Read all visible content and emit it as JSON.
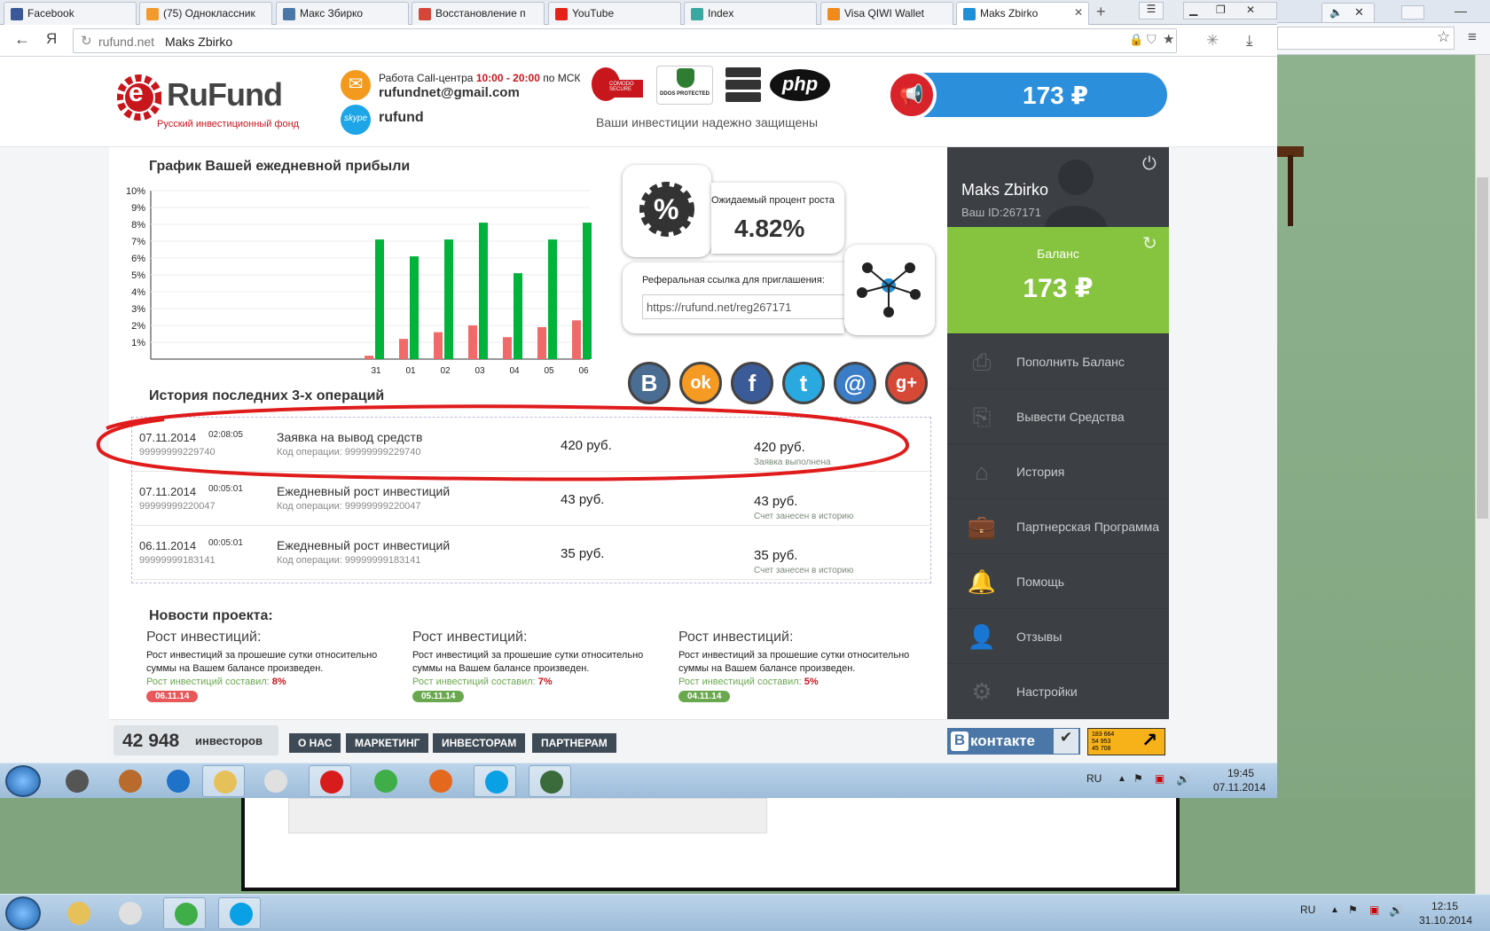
{
  "browser": {
    "tabs": [
      {
        "label": "Facebook",
        "color": "#3b5998"
      },
      {
        "label": "(75) Одноклассник",
        "color": "#f29a2e"
      },
      {
        "label": "Макс Збирко",
        "color": "#4a76a8"
      },
      {
        "label": "Восстановление п",
        "color": "#d44638"
      },
      {
        "label": "YouTube",
        "color": "#e62117"
      },
      {
        "label": "Index",
        "color": "#3aa7a0"
      },
      {
        "label": "Visa QIWI Wallet",
        "color": "#f08a1c"
      },
      {
        "label": "Maks Zbirko",
        "color": "#1e8fd6"
      }
    ],
    "back_icon": "back-arrow-icon",
    "yandex_logo": "Я",
    "url_domain": "rufund.net",
    "url_title": "Maks Zbirko"
  },
  "header": {
    "logo_text": "RuFund",
    "logo_letter": "e",
    "logo_sub": "Русский инвестиционный фонд",
    "callcenter_prefix": "Работа Call-центра ",
    "callcenter_hours": "10:00 - 20:00",
    "callcenter_suffix": " по МСК",
    "email": "rufundnet@gmail.com",
    "skype_icon_text": "skype",
    "skype": "rufund",
    "comodo_label": "COMODO SECURE",
    "ddos_label": "DDOS PROTECTED",
    "php_label": "php",
    "security_text": "Ваши инвестиции надежно защищены",
    "balance_display": "173 ₽"
  },
  "chart_data": {
    "type": "bar",
    "title": "График Вашей ежедневной прибыли",
    "categories": [
      "31",
      "01",
      "02",
      "03",
      "04",
      "05",
      "06"
    ],
    "yticks": [
      "10%",
      "9%",
      "8%",
      "7%",
      "6%",
      "5%",
      "4%",
      "3%",
      "2%",
      "1%"
    ],
    "ylim": [
      0,
      10
    ],
    "series": [
      {
        "name": "",
        "color": "#f06a6a",
        "values": [
          0.2,
          1.2,
          1.6,
          2.0,
          1.3,
          1.9,
          2.3
        ]
      },
      {
        "name": "",
        "color": "#00b33a",
        "values": [
          7.1,
          6.1,
          7.1,
          8.1,
          5.1,
          7.1,
          8.1
        ]
      }
    ]
  },
  "growth": {
    "label": "Ожидаемый процент роста",
    "value": "4.82%",
    "icon": "%"
  },
  "referral": {
    "label": "Реферальная ссылка для приглашения:",
    "url": "https://rufund.net/reg267171"
  },
  "social": [
    {
      "name": "vk",
      "glyph": "В",
      "color": "#4a6d93"
    },
    {
      "name": "odnoklassniki",
      "glyph": "ok",
      "color": "#f59a23"
    },
    {
      "name": "facebook",
      "glyph": "f",
      "color": "#3b5b98"
    },
    {
      "name": "twitter",
      "glyph": "t",
      "color": "#2aa8e0"
    },
    {
      "name": "email",
      "glyph": "@",
      "color": "#3a7cc6"
    },
    {
      "name": "google-plus",
      "glyph": "g+",
      "color": "#d64937"
    }
  ],
  "history": {
    "title": "История последних 3-х операций",
    "code_prefix": "Код операции: ",
    "rows": [
      {
        "date": "07.11.2014",
        "time": "02:08:05",
        "id": "99999999229740",
        "desc": "Заявка на вывод средств",
        "code": "99999999229740",
        "amount": "420 руб.",
        "amount2": "420 руб.",
        "status": "Заявка выполнена"
      },
      {
        "date": "07.11.2014",
        "time": "00:05:01",
        "id": "99999999220047",
        "desc": "Ежедневный рост инвестиций",
        "code": "99999999220047",
        "amount": "43 руб.",
        "amount2": "43 руб.",
        "status": "Счет занесен в историю"
      },
      {
        "date": "06.11.2014",
        "time": "00:05:01",
        "id": "99999999183141",
        "desc": "Ежедневный рост инвестиций",
        "code": "99999999183141",
        "amount": "35 руб.",
        "amount2": "35 руб.",
        "status": "Счет занесен в историю"
      }
    ]
  },
  "news": {
    "title": "Новости проекта:",
    "items": [
      {
        "title": "Рост инвестиций:",
        "text": "Рост инвестиций за прошешие сутки относительно суммы на Вашем балансе произведен.",
        "result_label": "Рост инвестиций составил: ",
        "result_value": "8%",
        "date": "06.11.14",
        "chip_color": "#e9575a"
      },
      {
        "title": "Рост инвестиций:",
        "text": "Рост инвестиций за прошешие сутки относительно суммы на Вашем балансе произведен.",
        "result_label": "Рост инвестиций составил: ",
        "result_value": "7%",
        "date": "05.11.14",
        "chip_color": "#6aa84f"
      },
      {
        "title": "Рост инвестиций:",
        "text": "Рост инвестиций за прошешие сутки относительно суммы на Вашем балансе произведен.",
        "result_label": "Рост инвестиций составил: ",
        "result_value": "5%",
        "date": "04.11.14",
        "chip_color": "#6aa84f"
      }
    ]
  },
  "sidebar": {
    "user_name": "Maks Zbirko",
    "user_id": "Ваш ID:267171",
    "balance_label": "Баланс",
    "balance": "173 ₽",
    "menu": [
      {
        "label": "Пополнить Баланс",
        "icon": "wallet-in-icon"
      },
      {
        "label": "Вывести Средства",
        "icon": "wallet-out-icon"
      },
      {
        "label": "История",
        "icon": "inbox-icon"
      },
      {
        "label": "Партнерская Программа",
        "icon": "briefcase-icon"
      },
      {
        "label": "Помощь",
        "icon": "bell-icon"
      },
      {
        "label": "Отзывы",
        "icon": "user-icon"
      },
      {
        "label": "Настройки",
        "icon": "gear-icon"
      }
    ]
  },
  "footer": {
    "investors_count": "42 948",
    "investors_label": "инвесторов",
    "buttons": [
      "О НАС",
      "МАРКЕТИНГ",
      "ИНВЕСТОРАМ",
      "ПАРТНЕРАМ"
    ],
    "vk_badge_b": "В",
    "vk_badge": "контакте",
    "counter_lines": [
      "183 664",
      "54 953",
      "45 708"
    ]
  },
  "taskbar1": {
    "lang": "RU",
    "time": "19:45",
    "date": "07.11.2014"
  },
  "taskbar2": {
    "lang": "RU",
    "time": "12:15",
    "date": "31.10.2014"
  }
}
